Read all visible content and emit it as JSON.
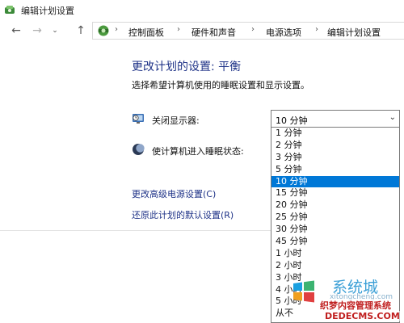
{
  "window": {
    "title": "编辑计划设置"
  },
  "nav": {
    "back_icon": "back-arrow-icon",
    "forward_icon": "forward-arrow-icon",
    "recent_icon": "chevron-down-icon",
    "up_icon": "up-arrow-icon"
  },
  "breadcrumb": [
    "控制面板",
    "硬件和声音",
    "电源选项",
    "编辑计划设置"
  ],
  "main": {
    "heading": "更改计划的设置: 平衡",
    "subheading": "选择希望计算机使用的睡眠设置和显示设置。",
    "display_off": {
      "label": "关闭显示器:",
      "value": "10 分钟"
    },
    "sleep": {
      "label": "使计算机进入睡眠状态:"
    },
    "links": {
      "advanced": "更改高级电源设置(C)",
      "restore": "还原此计划的默认设置(R)"
    }
  },
  "dropdown": {
    "options": [
      "1 分钟",
      "2 分钟",
      "3 分钟",
      "5 分钟",
      "10 分钟",
      "15 分钟",
      "20 分钟",
      "25 分钟",
      "30 分钟",
      "45 分钟",
      "1 小时",
      "2 小时",
      "3 小时",
      "4 小时",
      "5 小时",
      "从不"
    ],
    "selected_index": 4
  },
  "watermark": {
    "site_name": "系统城",
    "site_url": "xitongcheng.com",
    "brand": "织梦内容管理系统",
    "brand_url": "DEDECMS.COM"
  },
  "colors": {
    "accent": "#0078d7",
    "heading": "#1e3287",
    "link": "#1e3287"
  }
}
